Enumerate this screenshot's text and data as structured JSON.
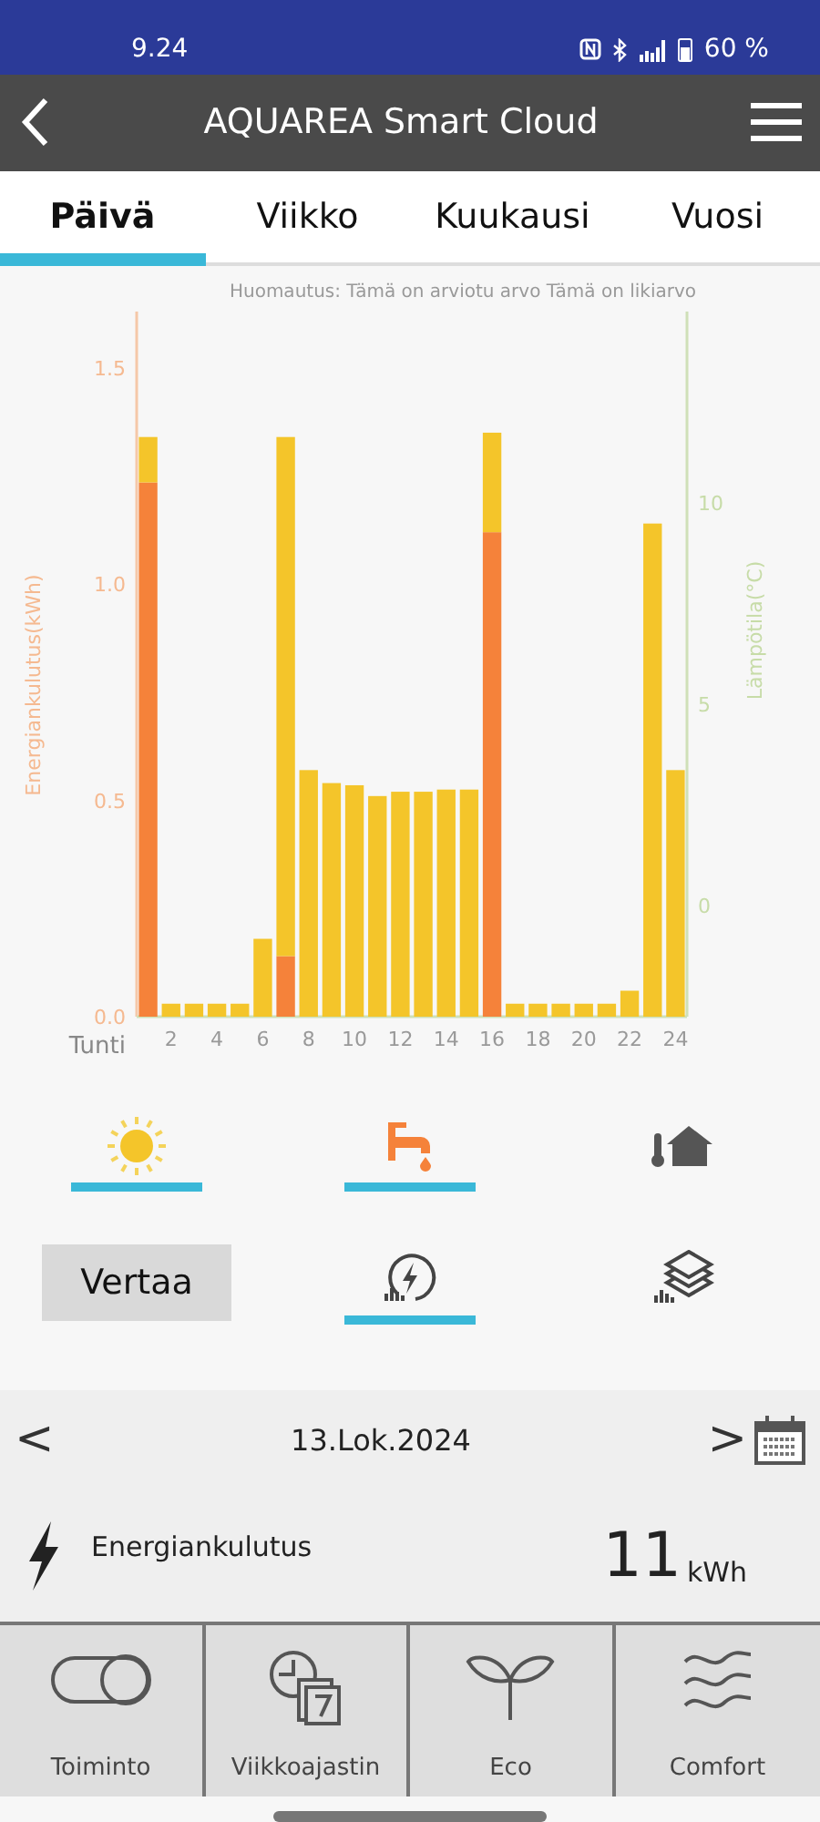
{
  "status_bar": {
    "time": "9.24",
    "battery": "60 %"
  },
  "app_bar": {
    "title": "AQUAREA Smart Cloud"
  },
  "tabs": [
    {
      "label": "Päivä",
      "selected": true
    },
    {
      "label": "Viikko",
      "selected": false
    },
    {
      "label": "Kuukausi",
      "selected": false
    },
    {
      "label": "Vuosi",
      "selected": false
    }
  ],
  "chart": {
    "note": "Huomautus: Tämä on arviotu arvo Tämä on likiarvo",
    "chart_data": {
      "type": "bar",
      "stacked": true,
      "xlabel": "Tunti",
      "ylabel": "Energiankulutus(kWh)",
      "y2label": "Lämpötila(°C)",
      "x": [
        1,
        2,
        3,
        4,
        5,
        6,
        7,
        8,
        9,
        10,
        11,
        12,
        13,
        14,
        15,
        16,
        17,
        18,
        19,
        20,
        21,
        22,
        23,
        24
      ],
      "xlim": [
        0.5,
        24.5
      ],
      "xticks": [
        2,
        4,
        6,
        8,
        10,
        12,
        14,
        16,
        18,
        20,
        22,
        24
      ],
      "ylim": [
        0,
        1.63
      ],
      "yticks": [
        {
          "value": 0,
          "label": "0.0"
        },
        {
          "value": 0.5,
          "label": "0.5"
        },
        {
          "value": 1,
          "label": "1.0"
        },
        {
          "value": 1.5,
          "label": "1.5"
        }
      ],
      "y2lim": [
        -2.76,
        14.75
      ],
      "y2ticks": [
        0,
        5,
        10
      ],
      "series": [
        {
          "color": "#f5823a",
          "values": [
            1.235,
            0,
            0,
            0,
            0,
            0,
            0.14,
            0,
            0,
            0,
            0,
            0,
            0,
            0,
            0,
            1.12,
            0,
            0,
            0,
            0,
            0,
            0,
            0,
            0
          ]
        },
        {
          "color": "#f4c52a",
          "values": [
            0.105,
            0.03,
            0.03,
            0.03,
            0.03,
            0.18,
            1.2,
            0.57,
            0.54,
            0.535,
            0.51,
            0.52,
            0.52,
            0.525,
            0.525,
            0.23,
            0.03,
            0.03,
            0.03,
            0.03,
            0.03,
            0.06,
            1.14,
            0.57
          ]
        }
      ]
    }
  },
  "modes": [
    {
      "kind": "sun",
      "selected": true
    },
    {
      "kind": "tap",
      "selected": true
    },
    {
      "kind": "house",
      "selected": false
    }
  ],
  "compare_button": "Vertaa",
  "views": [
    {
      "kind": "energy",
      "selected": true
    },
    {
      "kind": "layers",
      "selected": false
    }
  ],
  "date_nav": {
    "prev": "<",
    "date": "13.Lok.2024",
    "next": ">"
  },
  "summary": {
    "label": "Energiankulutus",
    "value": "11",
    "unit": "kWh"
  },
  "bottom_nav": [
    {
      "kind": "toggle",
      "label": "Toiminto"
    },
    {
      "kind": "schedule",
      "label": "Viikkoajastin"
    },
    {
      "kind": "eco",
      "label": "Eco"
    },
    {
      "kind": "comfort",
      "label": "Comfort"
    }
  ]
}
